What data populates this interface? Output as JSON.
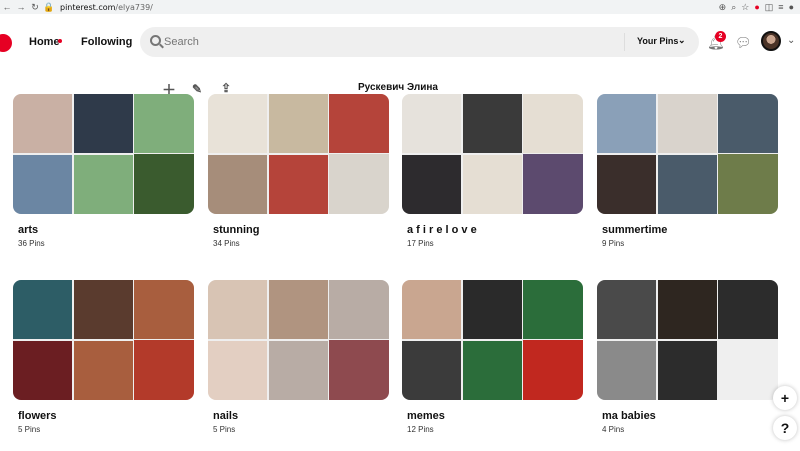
{
  "browser": {
    "url_host": "pinterest.com",
    "url_path": "/elya739/"
  },
  "header": {
    "home_label": "Home",
    "following_label": "Following",
    "search_placeholder": "Search",
    "your_pins_label": "Your Pins",
    "notification_count": "2",
    "brand_color": "#e60023"
  },
  "profile": {
    "name": "Рускевич Элина"
  },
  "boards": [
    {
      "title": "arts",
      "count": "36 Pins",
      "colors": [
        "#c9b0a4",
        "#2f3a4a",
        "#6b86a3",
        "#7fae7b",
        "#3a5b2e"
      ]
    },
    {
      "title": "stunning",
      "count": "34 Pins",
      "colors": [
        "#e8e2d8",
        "#c8b9a0",
        "#a68d7a",
        "#b5443a",
        "#d9d4cc"
      ]
    },
    {
      "title": "a f i r e l o v e",
      "count": "17 Pins",
      "colors": [
        "#e6e2dc",
        "#3a3a3a",
        "#2d2b2e",
        "#e5ded3",
        "#5c4a6e"
      ]
    },
    {
      "title": "summertime",
      "count": "9 Pins",
      "colors": [
        "#8aa0b8",
        "#d9d3cc",
        "#3a2e2b",
        "#4a5b6a",
        "#6e7c4a"
      ]
    },
    {
      "title": "flowers",
      "count": "5 Pins",
      "colors": [
        "#2d5d66",
        "#5a3b2e",
        "#6b1e22",
        "#a85e3e",
        "#b33a2a"
      ]
    },
    {
      "title": "nails",
      "count": "5 Pins",
      "colors": [
        "#d8c4b4",
        "#b09480",
        "#e3cfc2",
        "#b8aca5",
        "#8e4a4f"
      ]
    },
    {
      "title": "memes",
      "count": "12 Pins",
      "colors": [
        "#c9a690",
        "#2a2a2a",
        "#3b3b3b",
        "#2b6d3a",
        "#c1281f"
      ]
    },
    {
      "title": "ma babies",
      "count": "4 Pins",
      "colors": [
        "#4a4a4a",
        "#2e2620",
        "#8a8a8a",
        "#2c2c2c",
        "#efefef"
      ]
    }
  ]
}
